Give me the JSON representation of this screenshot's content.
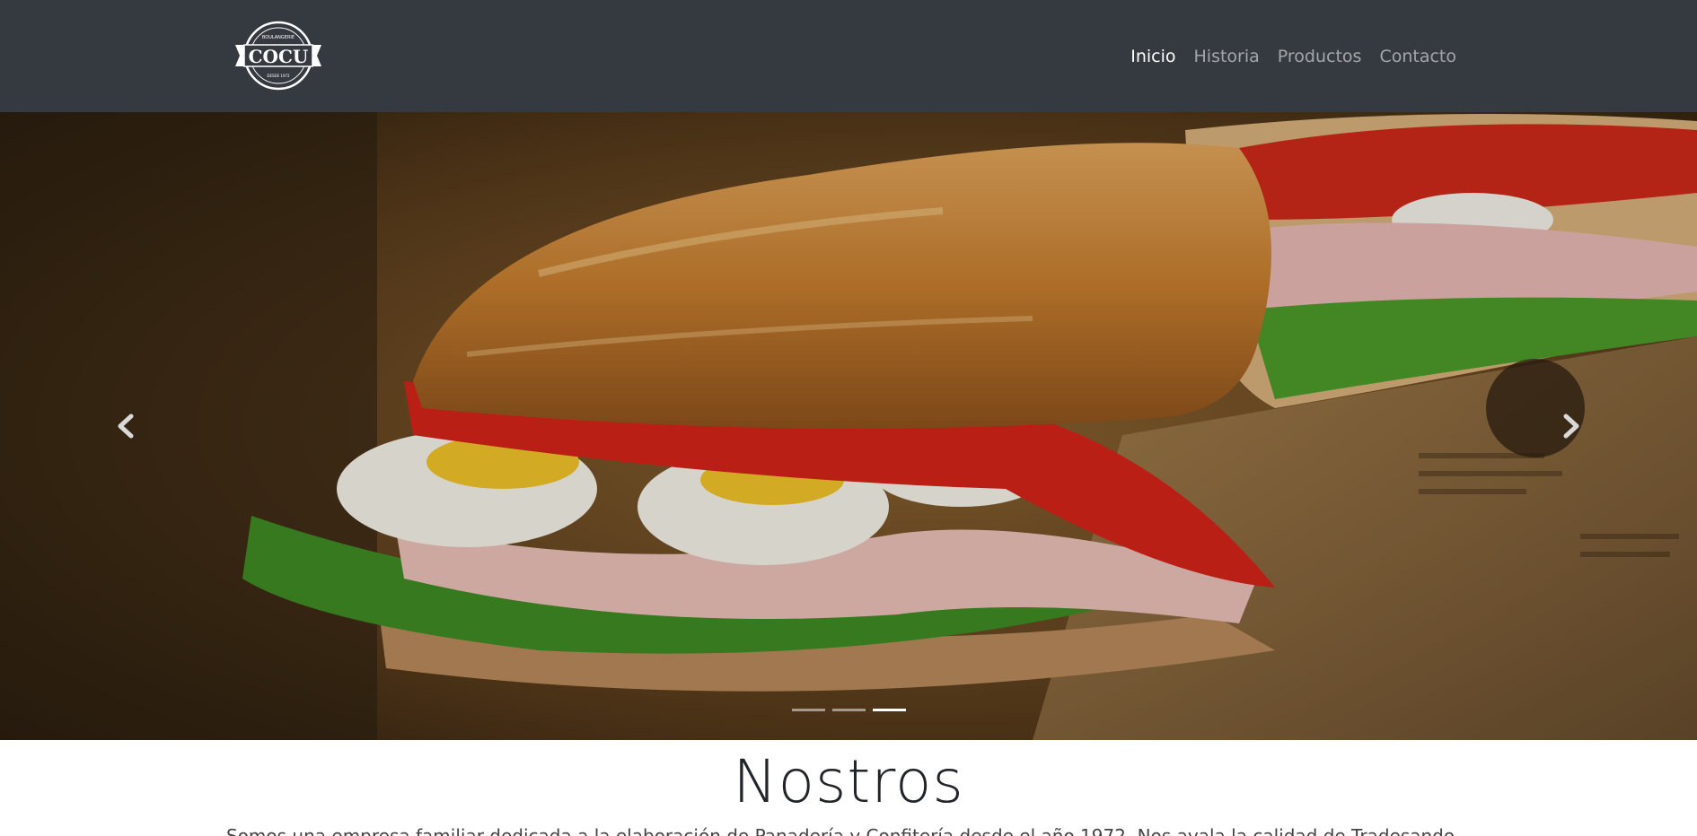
{
  "brand": {
    "name": "COCU",
    "top_text": "BOULANGERIE",
    "bottom_text": "DESDE 1972",
    "alt": "Cocu logo"
  },
  "nav": {
    "items": [
      {
        "label": "Inicio",
        "active": true
      },
      {
        "label": "Historia",
        "active": false
      },
      {
        "label": "Productos",
        "active": false
      },
      {
        "label": "Contacto",
        "active": false
      }
    ]
  },
  "carousel": {
    "prev_icon": "chevron-left-icon",
    "next_icon": "chevron-right-icon",
    "slide_count": 3,
    "active_slide": 3
  },
  "about": {
    "title": "Nostros",
    "text": "Somos una empresa familiar dedicada a la elaboración de Panadería y Confitería desde el año 1972. Nos avala la calidad de Tradesando"
  },
  "colors": {
    "navbar_bg": "#343a40",
    "nav_active": "#ffffff",
    "nav_inactive": "rgba(255,255,255,0.55)"
  }
}
